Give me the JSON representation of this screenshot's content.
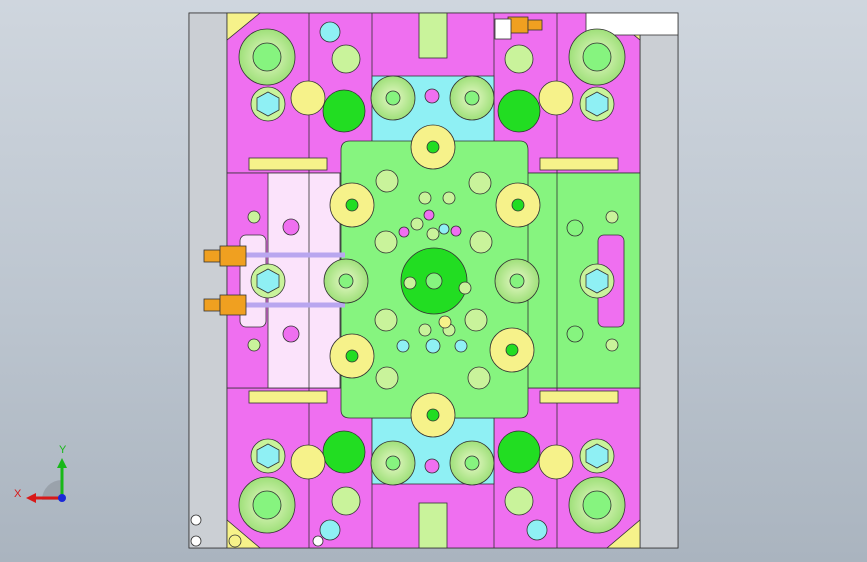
{
  "viewport": {
    "background_top": "#cfd6de",
    "background_bottom": "#aab4bf"
  },
  "colors": {
    "plate_gray": "#cbcfd4",
    "magenta": "#ef6ff0",
    "pale_pink": "#fbe3fb",
    "green": "#86f47f",
    "cyan": "#8ff0f4",
    "bright_green": "#22dd22",
    "light_green": "#c9f39b",
    "pale_green": "#e8f7c8",
    "yellow": "#f6f28a",
    "orange": "#f0a020",
    "outline": "#333333",
    "axis_x": "#d81818",
    "axis_y": "#18b818",
    "axis_z": "#1a28d8"
  },
  "triad": {
    "x_label": "X",
    "y_label": "Y"
  }
}
